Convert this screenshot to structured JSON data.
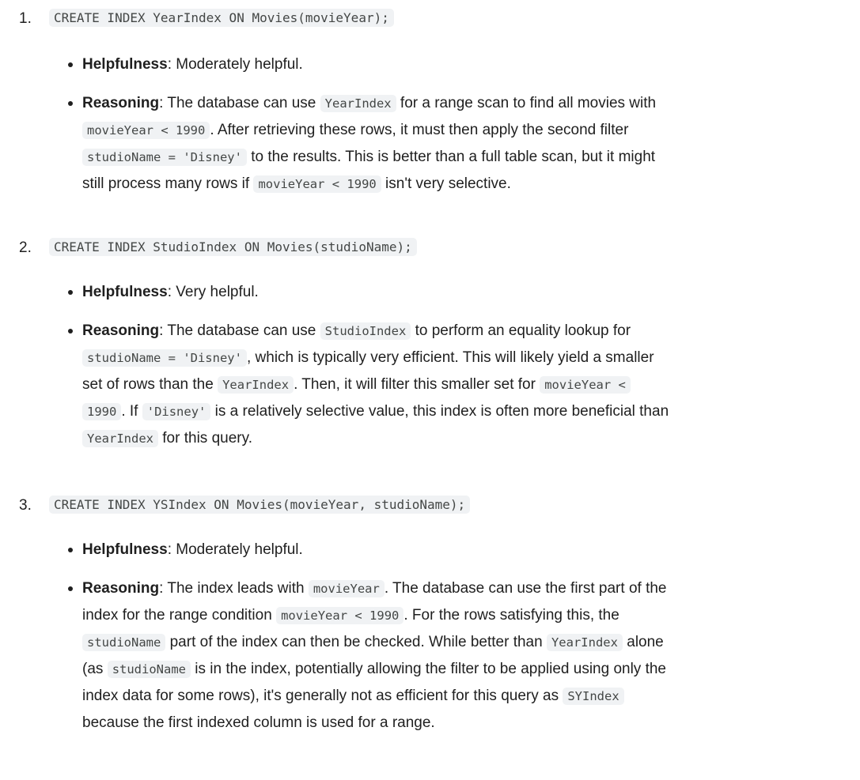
{
  "items": [
    {
      "num": "1.",
      "code": "CREATE INDEX YearIndex ON Movies(movieYear);",
      "helpfulness_label": "Helpfulness",
      "helpfulness_text": ": Moderately helpful.",
      "reasoning_label": "Reasoning",
      "reasoning_lines": [
        [
          ": The database can use ",
          "#YearIndex",
          " for a range scan to find all movies with"
        ],
        [
          "#movieYear < 1990",
          ". After retrieving these rows, it must then apply the second filter"
        ],
        [
          "#studioName = 'Disney'",
          " to the results. This is better than a full table scan, but it might"
        ],
        [
          "still process many rows if ",
          "#movieYear < 1990",
          " isn't very selective."
        ]
      ]
    },
    {
      "num": "2.",
      "code": "CREATE INDEX StudioIndex ON Movies(studioName);",
      "helpfulness_label": "Helpfulness",
      "helpfulness_text": ": Very helpful.",
      "reasoning_label": "Reasoning",
      "reasoning_lines": [
        [
          ": The database can use ",
          "#StudioIndex",
          " to perform an equality lookup for"
        ],
        [
          "#studioName = 'Disney'",
          ", which is typically very efficient. This will likely yield a smaller"
        ],
        [
          "set of rows than the ",
          "#YearIndex",
          ". Then, it will filter this smaller set for ",
          "#movieYear <"
        ],
        [
          "#1990",
          ". If ",
          "#'Disney'",
          " is a relatively selective value, this index is often more beneficial than"
        ],
        [
          "#YearIndex",
          " for this query."
        ]
      ]
    },
    {
      "num": "3.",
      "code": "CREATE INDEX YSIndex ON Movies(movieYear, studioName);",
      "helpfulness_label": "Helpfulness",
      "helpfulness_text": ": Moderately helpful.",
      "reasoning_label": "Reasoning",
      "reasoning_lines": [
        [
          ": The index leads with ",
          "#movieYear",
          ". The database can use the first part of the"
        ],
        [
          "index for the range condition ",
          "#movieYear < 1990",
          ". For the rows satisfying this, the"
        ],
        [
          "#studioName",
          " part of the index can then be checked. While better than ",
          "#YearIndex",
          " alone"
        ],
        [
          "(as ",
          "#studioName",
          " is in the index, potentially allowing the filter to be applied using only the"
        ],
        [
          "index data for some rows), it's generally not as efficient for this query as ",
          "#SYIndex"
        ],
        [
          "because the first indexed column is used for a range."
        ]
      ]
    }
  ]
}
